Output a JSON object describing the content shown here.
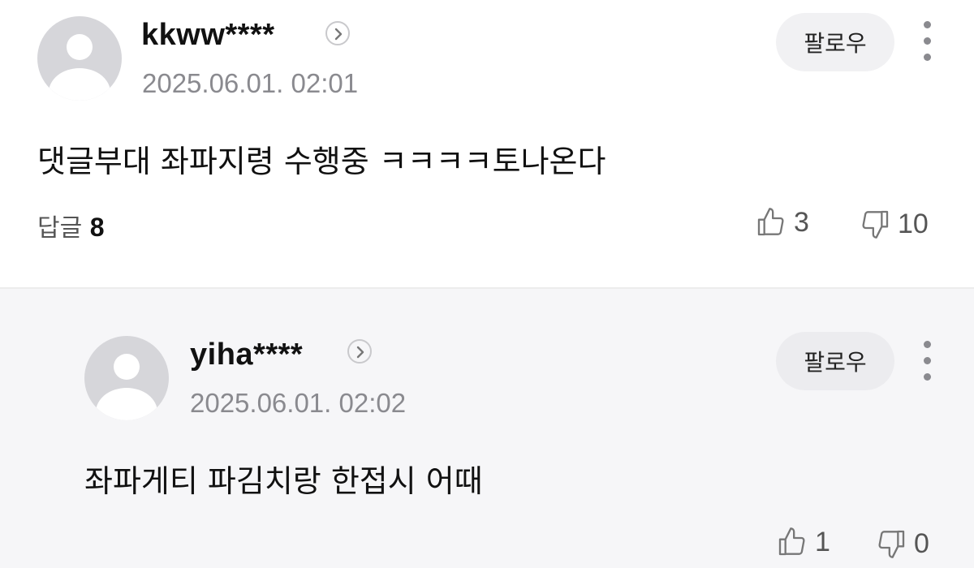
{
  "comments": [
    {
      "username": "kkww****",
      "timestamp": "2025.06.01. 02:01",
      "follow_label": "팔로우",
      "text": "댓글부대 좌파지령 수행중 ㅋㅋㅋㅋ토나온다",
      "reply_label": "답글",
      "reply_count": "8",
      "likes": "3",
      "dislikes": "10"
    },
    {
      "username": "yiha****",
      "timestamp": "2025.06.01. 02:02",
      "follow_label": "팔로우",
      "text": "좌파게티 파김치랑 한접시 어때",
      "likes": "1",
      "dislikes": "0"
    }
  ],
  "icons": {
    "avatar": "default-user-avatar",
    "profile_link": "chevron-right-circle-icon",
    "more": "vertical-ellipsis-icon",
    "like": "thumbs-up-outline-icon",
    "dislike": "thumbs-down-outline-icon"
  },
  "colors": {
    "reply_background": "#f6f6f8",
    "muted_text": "#8a8a8f",
    "button_background": "#f1f1f3"
  }
}
